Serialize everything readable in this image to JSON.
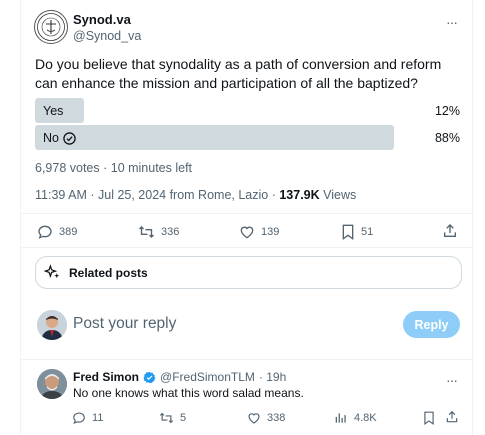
{
  "post": {
    "author_name": "Synod.va",
    "author_handle": "@Synod_va",
    "more_label": "···",
    "question": "Do you believe that synodality as a path of conversion and reform can enhance the mission and participation of all the baptized?",
    "poll": {
      "options": [
        {
          "label": "Yes",
          "percent_label": "12%",
          "percent": 12,
          "selected": false
        },
        {
          "label": "No",
          "percent_label": "88%",
          "percent": 88,
          "selected": true
        }
      ],
      "summary": "6,978 votes · 10 minutes left"
    },
    "timestamp": "11:39 AM · Jul 25, 2024 from Rome, Lazio · ",
    "views_count": "137.9K",
    "views_label": " Views",
    "actions": {
      "replies": "389",
      "reposts": "336",
      "likes": "139",
      "bookmarks": "51"
    }
  },
  "related_posts_label": "Related posts",
  "composer": {
    "placeholder": "Post your reply",
    "reply_button": "Reply"
  },
  "reply": {
    "author_name": "Fred Simon",
    "author_handle": "@FredSimonTLM",
    "time": "· 19h",
    "text": "No one knows what this word salad means.",
    "more_label": "···",
    "actions": {
      "replies": "11",
      "reposts": "5",
      "likes": "338",
      "views": "4.8K"
    }
  },
  "colors": {
    "poll_bar": "#cfd9de",
    "verified_badge": "#1d9bf0",
    "reply_button_disabled": "#8ecdf7",
    "secondary_text": "#536471"
  },
  "icons": [
    "seal-logo-icon",
    "more-icon",
    "check-circle-icon",
    "reply-icon",
    "repost-icon",
    "like-icon",
    "bookmark-icon",
    "share-icon",
    "sparkle-icon",
    "verified-badge-icon",
    "views-icon"
  ]
}
